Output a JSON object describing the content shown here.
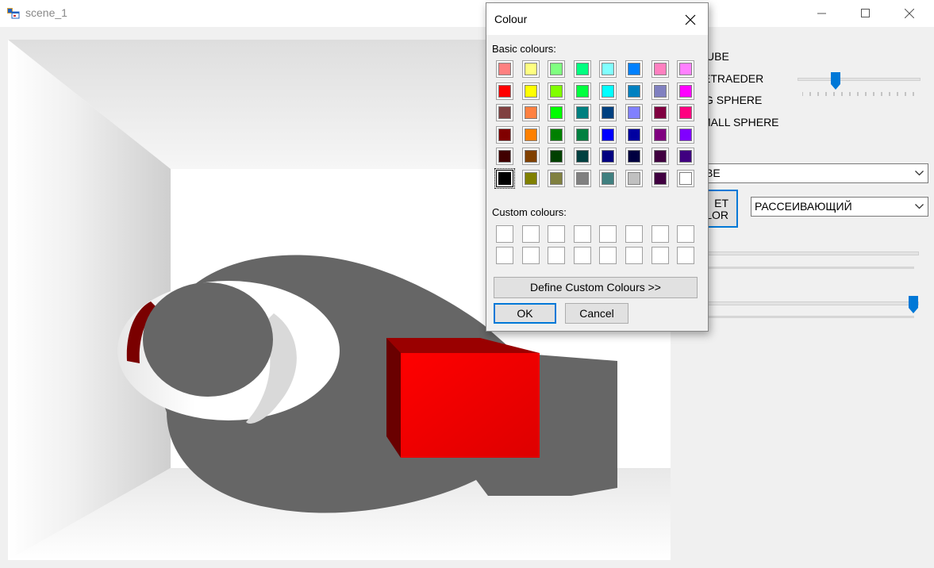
{
  "window": {
    "title": "scene_1",
    "icon": "windows-form-icon"
  },
  "panel": {
    "radio_labels": [
      "UBE",
      "ETRAEDER",
      "G SPHERE",
      "MALL SPHERE"
    ],
    "object_select": {
      "value": "BE"
    },
    "set_color_button": {
      "line1": "ET",
      "line2": "LOR"
    },
    "material_select": {
      "value": "РАССЕИВАЮЩИЙ"
    },
    "slider_top_level": 0.3,
    "slider_bottom_level": 1.0
  },
  "dialog": {
    "title": "Colour",
    "basic_label": "Basic colours:",
    "custom_label": "Custom colours:",
    "define_button": "Define Custom Colours >>",
    "ok_button": "OK",
    "cancel_button": "Cancel",
    "selected_index": 40,
    "basic_colors": [
      "#ff8080",
      "#ffff80",
      "#80ff80",
      "#00ff80",
      "#80ffff",
      "#0080ff",
      "#ff80c0",
      "#ff80ff",
      "#ff0000",
      "#ffff00",
      "#80ff00",
      "#00ff40",
      "#00ffff",
      "#0080c0",
      "#8080c0",
      "#ff00ff",
      "#804040",
      "#ff8040",
      "#00ff00",
      "#008080",
      "#004080",
      "#8080ff",
      "#800040",
      "#ff0080",
      "#800000",
      "#ff8000",
      "#008000",
      "#008040",
      "#0000ff",
      "#0000a0",
      "#800080",
      "#8000ff",
      "#400000",
      "#804000",
      "#004000",
      "#004040",
      "#000080",
      "#000040",
      "#400040",
      "#400080",
      "#000000",
      "#808000",
      "#808040",
      "#808080",
      "#408080",
      "#c0c0c0",
      "#400040",
      "#ffffff"
    ],
    "custom_colors": [
      "#ffffff",
      "#ffffff",
      "#ffffff",
      "#ffffff",
      "#ffffff",
      "#ffffff",
      "#ffffff",
      "#ffffff",
      "#ffffff",
      "#ffffff",
      "#ffffff",
      "#ffffff",
      "#ffffff",
      "#ffffff",
      "#ffffff",
      "#ffffff"
    ]
  }
}
